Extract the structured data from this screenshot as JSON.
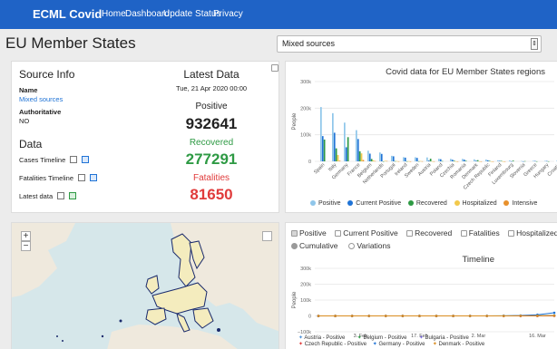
{
  "nav": {
    "brand": "ECML Covid",
    "links": [
      "Home",
      "Dashboard",
      "Update Status",
      "Privacy"
    ]
  },
  "page": {
    "title": "EU Member States",
    "source_select": {
      "value": "Mixed sources"
    }
  },
  "source_info": {
    "heading": "Source Info",
    "name_label": "Name",
    "name_value": "Mixed sources",
    "authoritative_label": "Authoritative",
    "authoritative_value": "NO",
    "data_heading": "Data",
    "rows": [
      "Cases Timeline",
      "Fatalities Timeline",
      "Latest data"
    ]
  },
  "latest": {
    "title": "Latest Data",
    "date": "Tue, 21 Apr 2020 00:00",
    "positive_label": "Positive",
    "positive_value": "932641",
    "recovered_label": "Recovered",
    "recovered_value": "277291",
    "fatalities_label": "Fatalities",
    "fatalities_value": "81650"
  },
  "colors": {
    "nav": "#1f63c6",
    "positive": "#8fc6ea",
    "current_positive": "#1f73d6",
    "recovered": "#2e9a44",
    "hospitalized": "#f2c94c",
    "intensive": "#e8912d",
    "recovered_text": "#2e9a44",
    "fatalities_text": "#e03b3b"
  },
  "map": {
    "zoom_in": "+",
    "zoom_out": "−"
  },
  "timeline_controls": {
    "checkboxes": [
      {
        "label": "Positive",
        "checked": true
      },
      {
        "label": "Current Positive",
        "checked": false
      },
      {
        "label": "Recovered",
        "checked": false
      },
      {
        "label": "Fatalities",
        "checked": false
      },
      {
        "label": "Hospitalized",
        "checked": false
      }
    ],
    "radios": [
      {
        "label": "Cumulative",
        "selected": true
      },
      {
        "label": "Variations",
        "selected": false
      }
    ]
  },
  "chart_data": [
    {
      "type": "bar",
      "title": "Covid data for EU Member States regions",
      "ylabel": "People",
      "ylim": [
        0,
        300000
      ],
      "yticks": [
        "0",
        "100k",
        "200k",
        "300k"
      ],
      "categories": [
        "Spain",
        "Italy",
        "Germany",
        "France",
        "Belgium",
        "Netherlands",
        "Portugal",
        "Ireland",
        "Sweden",
        "Austria",
        "Poland",
        "Czechia",
        "Romania",
        "Denmark",
        "Czech Republic",
        "Finland",
        "Luxembourg",
        "Slovenia",
        "Greece",
        "Hungary",
        "Croatia"
      ],
      "series": [
        {
          "name": "Positive",
          "values": [
            204178,
            181228,
            145694,
            117324,
            39983,
            33405,
            20863,
            15652,
            15322,
            14795,
            9856,
            9300,
            9242,
            7515,
            6900,
            4014,
            3618,
            1336,
            2245,
            1984,
            1908
          ]
        },
        {
          "name": "Current Positive",
          "values": [
            95000,
            107699,
            53000,
            84000,
            29000,
            28000,
            19000,
            14000,
            13000,
            3000,
            8000,
            6000,
            6500,
            2500,
            4000,
            2000,
            600,
            300,
            1500,
            1400,
            900
          ]
        },
        {
          "name": "Recovered",
          "values": [
            82000,
            48877,
            91000,
            38000,
            9000,
            250,
            900,
            500,
            550,
            10000,
            1200,
            2500,
            2300,
            4500,
            2000,
            1800,
            2900,
            1000,
            300,
            300,
            700
          ]
        },
        {
          "name": "Hospitalized",
          "values": [
            0,
            24000,
            0,
            30000,
            3900,
            2000,
            1100,
            800,
            1200,
            700,
            0,
            350,
            0,
            330,
            200,
            200,
            0,
            0,
            0,
            0,
            0
          ]
        },
        {
          "name": "Intensive",
          "values": [
            0,
            2500,
            0,
            5400,
            1100,
            1300,
            200,
            150,
            500,
            200,
            0,
            90,
            0,
            80,
            50,
            70,
            0,
            0,
            0,
            0,
            0
          ]
        }
      ],
      "legend": [
        "Positive",
        "Current Positive",
        "Recovered",
        "Hospitalized",
        "Intensive"
      ]
    },
    {
      "type": "line",
      "title": "Timeline",
      "ylabel": "People",
      "ylim": [
        -100000,
        300000
      ],
      "yticks": [
        "−100k",
        "0",
        "100k",
        "200k",
        "300k"
      ],
      "x_ticks": [
        "3. Feb",
        "17. Feb",
        "2. Mar",
        "16. Mar"
      ],
      "x": [
        "2020-01-24",
        "2020-01-28",
        "2020-02-01",
        "2020-02-05",
        "2020-02-09",
        "2020-02-13",
        "2020-02-17",
        "2020-02-21",
        "2020-02-25",
        "2020-02-29",
        "2020-03-04",
        "2020-03-08",
        "2020-03-12",
        "2020-03-16",
        "2020-03-20"
      ],
      "series": [
        {
          "name": "Austria - Positive",
          "values": [
            0,
            0,
            0,
            0,
            0,
            0,
            0,
            0,
            2,
            9,
            29,
            104,
            302,
            1016,
            2388
          ]
        },
        {
          "name": "Belgium - Positive",
          "values": [
            0,
            0,
            0,
            1,
            1,
            1,
            1,
            1,
            1,
            2,
            23,
            200,
            400,
            1058,
            2257
          ]
        },
        {
          "name": "Bulgaria - Positive",
          "values": [
            0,
            0,
            0,
            0,
            0,
            0,
            0,
            0,
            0,
            0,
            0,
            4,
            7,
            51,
            127
          ]
        },
        {
          "name": "Czech Republic - Positive",
          "values": [
            0,
            0,
            0,
            0,
            0,
            0,
            0,
            0,
            0,
            0,
            5,
            26,
            94,
            298,
            833
          ]
        },
        {
          "name": "Germany - Positive",
          "values": [
            0,
            4,
            10,
            12,
            14,
            16,
            16,
            16,
            18,
            79,
            262,
            1040,
            2745,
            7272,
            19848
          ]
        },
        {
          "name": "Denmark - Positive",
          "values": [
            0,
            0,
            0,
            0,
            0,
            0,
            0,
            0,
            0,
            1,
            10,
            35,
            674,
            898,
            1326
          ]
        }
      ],
      "legend": [
        "Austria - Positive",
        "Belgium - Positive",
        "Bulgaria - Positive",
        "Czech Republic - Positive",
        "Germany - Positive",
        "Denmark - Positive"
      ]
    }
  ]
}
